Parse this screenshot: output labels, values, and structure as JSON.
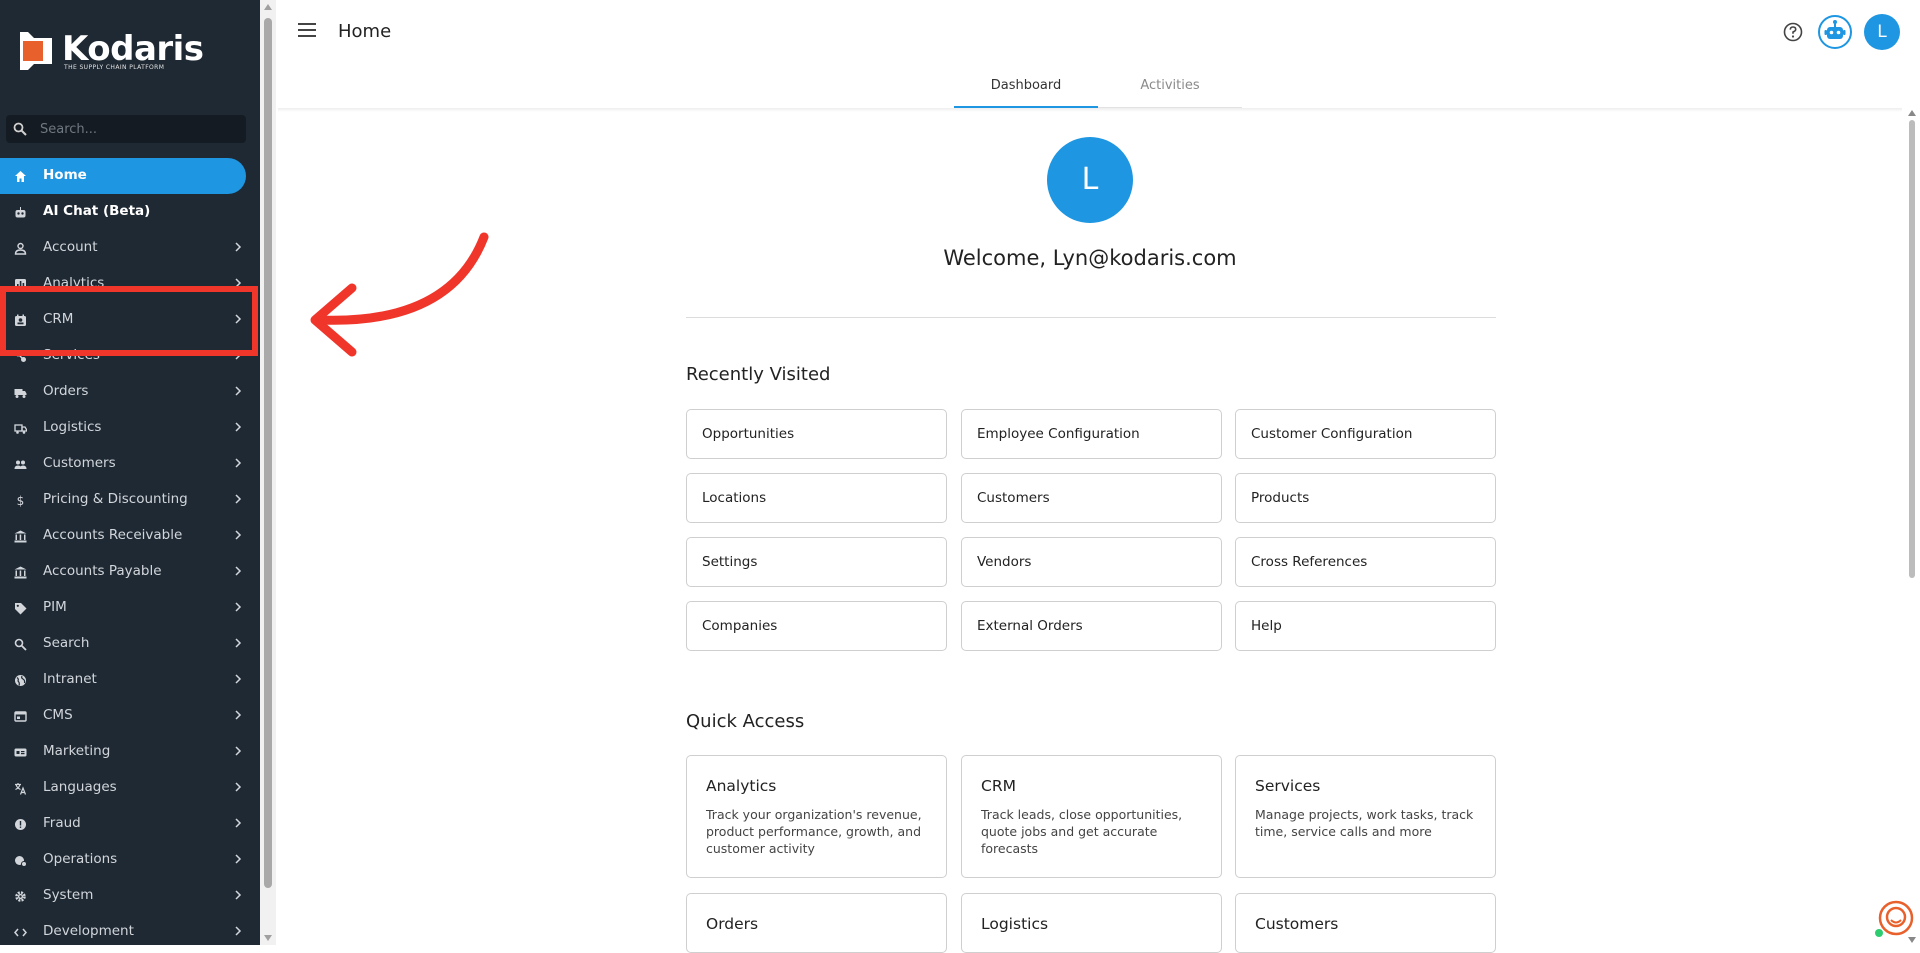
{
  "brand": {
    "name": "Kodaris",
    "tagline": "THE SUPPLY CHAIN PLATFORM",
    "accent": "#1e96e1",
    "sidebar_bg": "#1f2933",
    "logo_orange": "#e8612c"
  },
  "sidebar": {
    "search_placeholder": "Search...",
    "items": [
      {
        "label": "Home",
        "icon": "home-icon",
        "active": true
      },
      {
        "label": "AI Chat (Beta)",
        "icon": "robot-icon"
      },
      {
        "label": "Account",
        "icon": "person-icon",
        "chevron": true
      },
      {
        "label": "Analytics",
        "icon": "chart-icon",
        "chevron": true
      },
      {
        "label": "CRM",
        "icon": "contact-card-icon",
        "chevron": true
      },
      {
        "label": "Services",
        "icon": "services-icon",
        "chevron": true
      },
      {
        "label": "Orders",
        "icon": "truck-icon",
        "chevron": true
      },
      {
        "label": "Logistics",
        "icon": "shipping-icon",
        "chevron": true
      },
      {
        "label": "Customers",
        "icon": "people-icon",
        "chevron": true
      },
      {
        "label": "Pricing & Discounting",
        "icon": "dollar-icon",
        "chevron": true
      },
      {
        "label": "Accounts Receivable",
        "icon": "bank-icon",
        "chevron": true
      },
      {
        "label": "Accounts Payable",
        "icon": "bank-icon",
        "chevron": true
      },
      {
        "label": "PIM",
        "icon": "tag-icon",
        "chevron": true
      },
      {
        "label": "Search",
        "icon": "search-icon",
        "chevron": true
      },
      {
        "label": "Intranet",
        "icon": "globe-icon",
        "chevron": true
      },
      {
        "label": "CMS",
        "icon": "window-icon",
        "chevron": true
      },
      {
        "label": "Marketing",
        "icon": "ad-icon",
        "chevron": true
      },
      {
        "label": "Languages",
        "icon": "translate-icon",
        "chevron": true
      },
      {
        "label": "Fraud",
        "icon": "alert-icon",
        "chevron": true
      },
      {
        "label": "Operations",
        "icon": "operations-icon",
        "chevron": true
      },
      {
        "label": "System",
        "icon": "gear-icon",
        "chevron": true
      },
      {
        "label": "Development",
        "icon": "code-icon",
        "chevron": true
      }
    ]
  },
  "header": {
    "title": "Home",
    "avatar_initial": "L"
  },
  "tabs": [
    {
      "label": "Dashboard",
      "active": true
    },
    {
      "label": "Activities"
    }
  ],
  "welcome": {
    "initial": "L",
    "text": "Welcome, Lyn@kodaris.com"
  },
  "recently_visited": {
    "title": "Recently Visited",
    "items": [
      "Opportunities",
      "Employee Configuration",
      "Customer Configuration",
      "Locations",
      "Customers",
      "Products",
      "Settings",
      "Vendors",
      "Cross References",
      "Companies",
      "External Orders",
      "Help"
    ]
  },
  "quick_access": {
    "title": "Quick Access",
    "items": [
      {
        "title": "Analytics",
        "desc": "Track your organization's revenue, product performance, growth, and customer activity"
      },
      {
        "title": "CRM",
        "desc": "Track leads, close opportunities, quote jobs and get accurate forecasts"
      },
      {
        "title": "Services",
        "desc": "Manage projects, work tasks, track time, service calls and more"
      },
      {
        "title": "Orders",
        "desc": ""
      },
      {
        "title": "Logistics",
        "desc": ""
      },
      {
        "title": "Customers",
        "desc": ""
      }
    ]
  },
  "annotation": {
    "color": "#f0352a",
    "target": "CRM"
  }
}
